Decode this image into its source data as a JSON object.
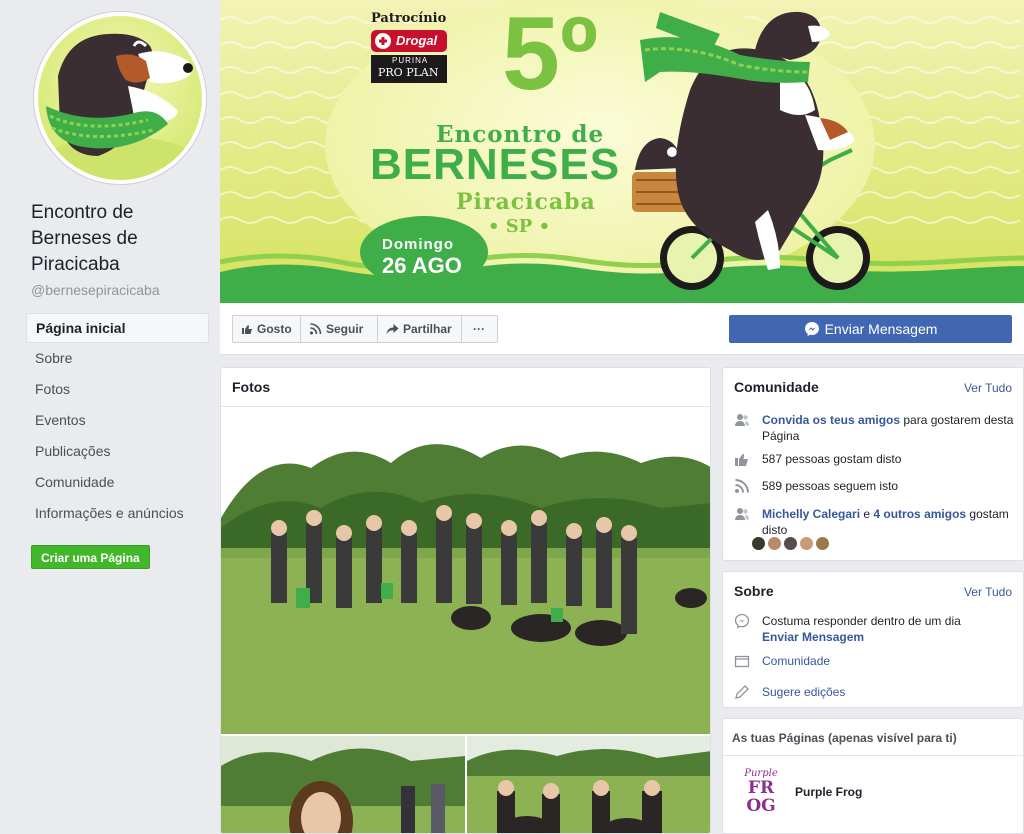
{
  "sidebar": {
    "page_name": "Encontro de Berneses de Piracicaba",
    "handle": "@bernesepiracicaba",
    "nav": [
      {
        "label": "Página inicial",
        "active": true
      },
      {
        "label": "Sobre"
      },
      {
        "label": "Fotos"
      },
      {
        "label": "Eventos"
      },
      {
        "label": "Publicações"
      },
      {
        "label": "Comunidade"
      },
      {
        "label": "Informações e anúncios"
      }
    ],
    "create_page_label": "Criar uma Página"
  },
  "cover": {
    "sponsor_label": "Patrocínio",
    "sponsor_1": "Drogal",
    "sponsor_2_top": "PURINA",
    "sponsor_2": "PRO PLAN",
    "edition": "5º",
    "line1": "Encontro de",
    "line2": "BERNESES",
    "city": "Piracicaba",
    "state": "• SP •",
    "day": "Domingo",
    "date": "26 AGO"
  },
  "actions": {
    "like": "Gosto",
    "follow": "Seguir",
    "share": "Partilhar",
    "more": "···",
    "message": "Enviar Mensagem"
  },
  "photos": {
    "title": "Fotos"
  },
  "community": {
    "title": "Comunidade",
    "see_all": "Ver Tudo",
    "invite_link": "Convida os teus amigos",
    "invite_rest": " para gostarem desta Página",
    "likes": "587 pessoas gostam disto",
    "follows": "589 pessoas seguem isto",
    "friend_name": "Michelly Calegari",
    "friend_and": " e ",
    "friend_others": "4 outros amigos",
    "friend_rest": " gostam disto"
  },
  "about": {
    "title": "Sobre",
    "see_all": "Ver Tudo",
    "response": "Costuma responder dentro de um dia",
    "send_message": "Enviar Mensagem",
    "category": "Comunidade",
    "suggest": "Sugere edições"
  },
  "your_pages": {
    "title": "As tuas Páginas (apenas visível para ti)",
    "logo_text_1": "Purple",
    "logo_text_2": "FR",
    "logo_text_3": "OG",
    "page_name": "Purple Frog"
  },
  "colors": {
    "fb_blue": "#4267b2",
    "link": "#365899",
    "green_button": "#42b72a",
    "cover_green": "#3fae49",
    "cover_lime": "#dfe86a"
  }
}
